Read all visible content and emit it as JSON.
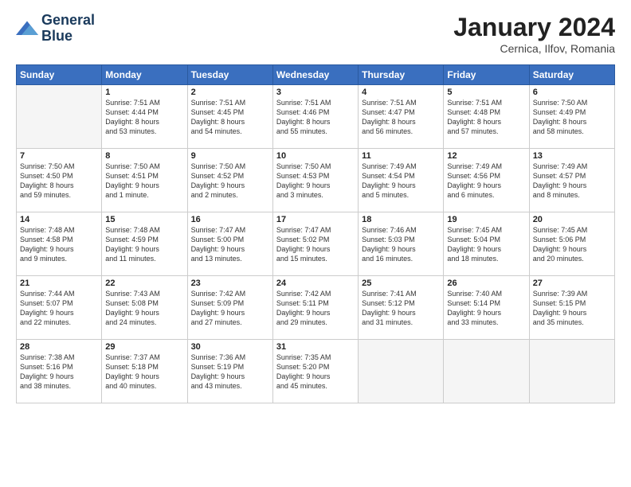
{
  "header": {
    "logo_line1": "General",
    "logo_line2": "Blue",
    "month_title": "January 2024",
    "location": "Cernica, Ilfov, Romania"
  },
  "days_of_week": [
    "Sunday",
    "Monday",
    "Tuesday",
    "Wednesday",
    "Thursday",
    "Friday",
    "Saturday"
  ],
  "weeks": [
    [
      {
        "day": "",
        "info": ""
      },
      {
        "day": "1",
        "info": "Sunrise: 7:51 AM\nSunset: 4:44 PM\nDaylight: 8 hours\nand 53 minutes."
      },
      {
        "day": "2",
        "info": "Sunrise: 7:51 AM\nSunset: 4:45 PM\nDaylight: 8 hours\nand 54 minutes."
      },
      {
        "day": "3",
        "info": "Sunrise: 7:51 AM\nSunset: 4:46 PM\nDaylight: 8 hours\nand 55 minutes."
      },
      {
        "day": "4",
        "info": "Sunrise: 7:51 AM\nSunset: 4:47 PM\nDaylight: 8 hours\nand 56 minutes."
      },
      {
        "day": "5",
        "info": "Sunrise: 7:51 AM\nSunset: 4:48 PM\nDaylight: 8 hours\nand 57 minutes."
      },
      {
        "day": "6",
        "info": "Sunrise: 7:50 AM\nSunset: 4:49 PM\nDaylight: 8 hours\nand 58 minutes."
      }
    ],
    [
      {
        "day": "7",
        "info": "Sunrise: 7:50 AM\nSunset: 4:50 PM\nDaylight: 8 hours\nand 59 minutes."
      },
      {
        "day": "8",
        "info": "Sunrise: 7:50 AM\nSunset: 4:51 PM\nDaylight: 9 hours\nand 1 minute."
      },
      {
        "day": "9",
        "info": "Sunrise: 7:50 AM\nSunset: 4:52 PM\nDaylight: 9 hours\nand 2 minutes."
      },
      {
        "day": "10",
        "info": "Sunrise: 7:50 AM\nSunset: 4:53 PM\nDaylight: 9 hours\nand 3 minutes."
      },
      {
        "day": "11",
        "info": "Sunrise: 7:49 AM\nSunset: 4:54 PM\nDaylight: 9 hours\nand 5 minutes."
      },
      {
        "day": "12",
        "info": "Sunrise: 7:49 AM\nSunset: 4:56 PM\nDaylight: 9 hours\nand 6 minutes."
      },
      {
        "day": "13",
        "info": "Sunrise: 7:49 AM\nSunset: 4:57 PM\nDaylight: 9 hours\nand 8 minutes."
      }
    ],
    [
      {
        "day": "14",
        "info": "Sunrise: 7:48 AM\nSunset: 4:58 PM\nDaylight: 9 hours\nand 9 minutes."
      },
      {
        "day": "15",
        "info": "Sunrise: 7:48 AM\nSunset: 4:59 PM\nDaylight: 9 hours\nand 11 minutes."
      },
      {
        "day": "16",
        "info": "Sunrise: 7:47 AM\nSunset: 5:00 PM\nDaylight: 9 hours\nand 13 minutes."
      },
      {
        "day": "17",
        "info": "Sunrise: 7:47 AM\nSunset: 5:02 PM\nDaylight: 9 hours\nand 15 minutes."
      },
      {
        "day": "18",
        "info": "Sunrise: 7:46 AM\nSunset: 5:03 PM\nDaylight: 9 hours\nand 16 minutes."
      },
      {
        "day": "19",
        "info": "Sunrise: 7:45 AM\nSunset: 5:04 PM\nDaylight: 9 hours\nand 18 minutes."
      },
      {
        "day": "20",
        "info": "Sunrise: 7:45 AM\nSunset: 5:06 PM\nDaylight: 9 hours\nand 20 minutes."
      }
    ],
    [
      {
        "day": "21",
        "info": "Sunrise: 7:44 AM\nSunset: 5:07 PM\nDaylight: 9 hours\nand 22 minutes."
      },
      {
        "day": "22",
        "info": "Sunrise: 7:43 AM\nSunset: 5:08 PM\nDaylight: 9 hours\nand 24 minutes."
      },
      {
        "day": "23",
        "info": "Sunrise: 7:42 AM\nSunset: 5:09 PM\nDaylight: 9 hours\nand 27 minutes."
      },
      {
        "day": "24",
        "info": "Sunrise: 7:42 AM\nSunset: 5:11 PM\nDaylight: 9 hours\nand 29 minutes."
      },
      {
        "day": "25",
        "info": "Sunrise: 7:41 AM\nSunset: 5:12 PM\nDaylight: 9 hours\nand 31 minutes."
      },
      {
        "day": "26",
        "info": "Sunrise: 7:40 AM\nSunset: 5:14 PM\nDaylight: 9 hours\nand 33 minutes."
      },
      {
        "day": "27",
        "info": "Sunrise: 7:39 AM\nSunset: 5:15 PM\nDaylight: 9 hours\nand 35 minutes."
      }
    ],
    [
      {
        "day": "28",
        "info": "Sunrise: 7:38 AM\nSunset: 5:16 PM\nDaylight: 9 hours\nand 38 minutes."
      },
      {
        "day": "29",
        "info": "Sunrise: 7:37 AM\nSunset: 5:18 PM\nDaylight: 9 hours\nand 40 minutes."
      },
      {
        "day": "30",
        "info": "Sunrise: 7:36 AM\nSunset: 5:19 PM\nDaylight: 9 hours\nand 43 minutes."
      },
      {
        "day": "31",
        "info": "Sunrise: 7:35 AM\nSunset: 5:20 PM\nDaylight: 9 hours\nand 45 minutes."
      },
      {
        "day": "",
        "info": ""
      },
      {
        "day": "",
        "info": ""
      },
      {
        "day": "",
        "info": ""
      }
    ]
  ]
}
